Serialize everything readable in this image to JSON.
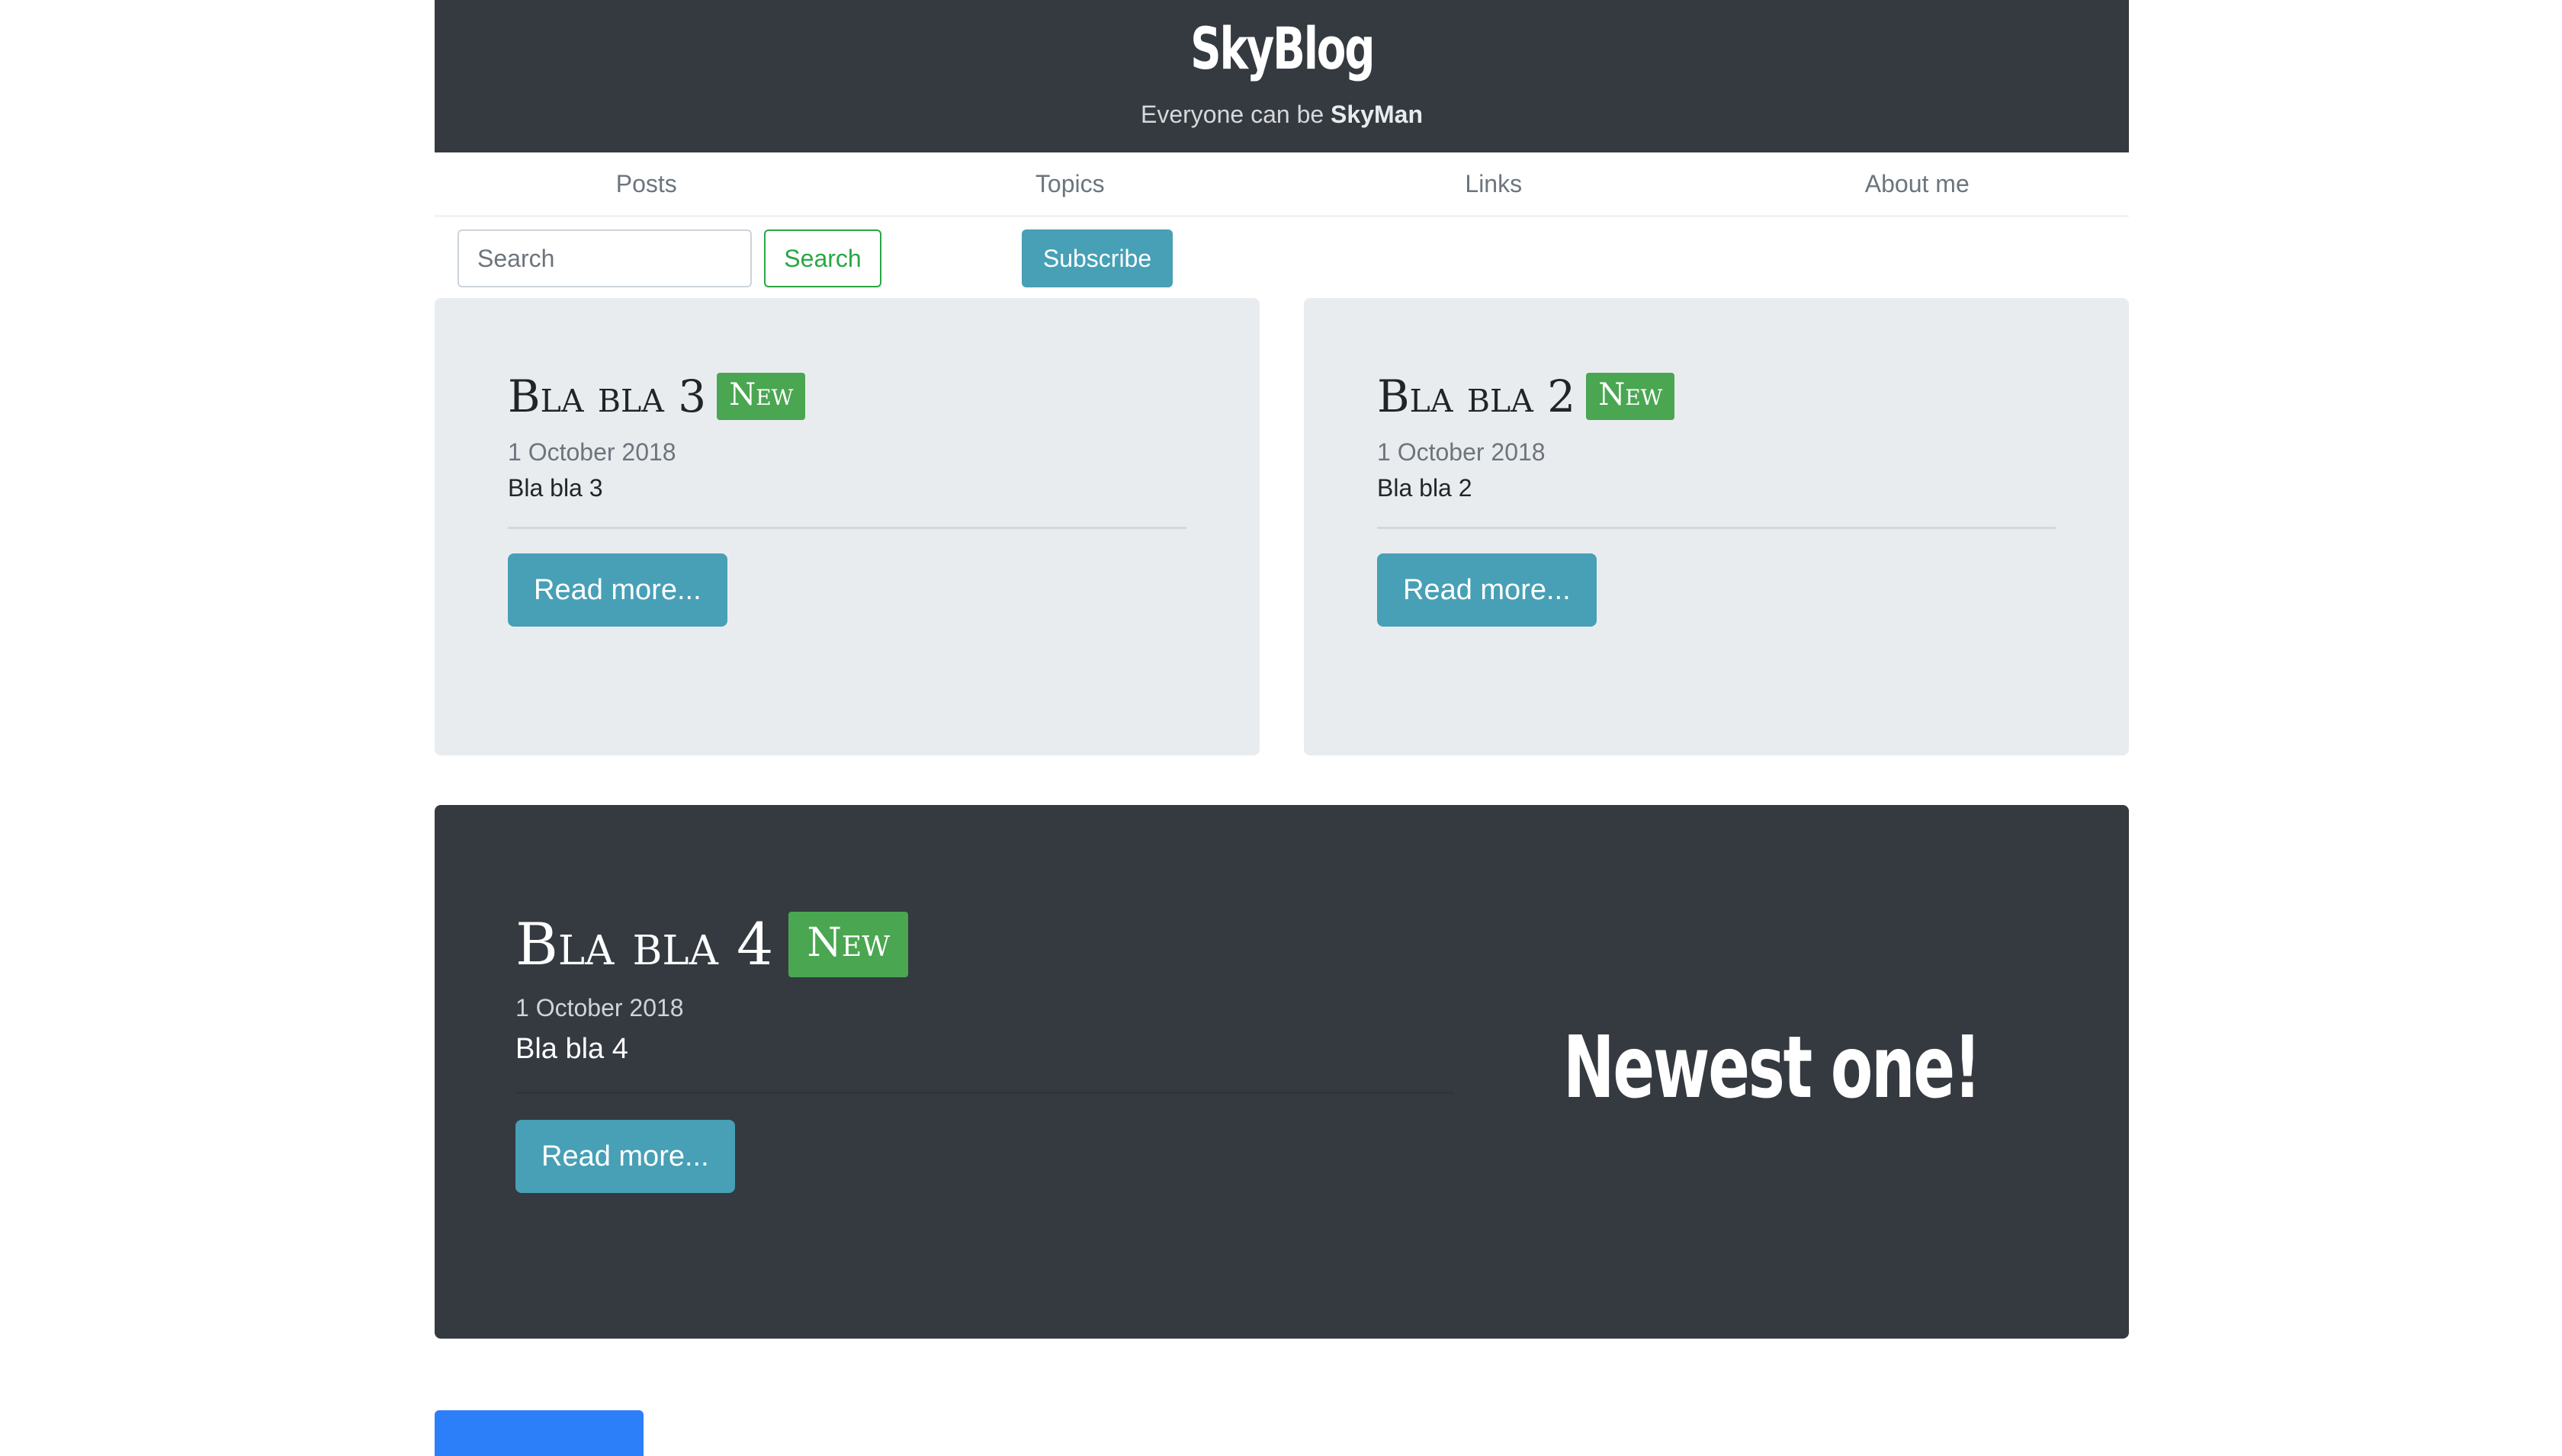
{
  "header": {
    "brand": "SkyBlog",
    "tagline_prefix": "Everyone can be",
    "tagline_name": "SkyMan"
  },
  "nav": {
    "items": [
      "Posts",
      "Topics",
      "Links",
      "About me"
    ]
  },
  "toolbar": {
    "search_placeholder": "Search",
    "search_button": "Search",
    "subscribe_button": "Subscribe"
  },
  "posts": [
    {
      "title": "Bla bla 3",
      "badge": "New",
      "date": "1 October 2018",
      "excerpt": "Bla bla 3",
      "read_more": "Read more..."
    },
    {
      "title": "Bla bla 2",
      "badge": "New",
      "date": "1 October 2018",
      "excerpt": "Bla bla 2",
      "read_more": "Read more..."
    }
  ],
  "featured": {
    "title": "Bla bla 4",
    "badge": "New",
    "date": "1 October 2018",
    "excerpt": "Bla bla 4",
    "read_more": "Read more...",
    "headline": "Newest one!"
  },
  "colors": {
    "dark": "#343a40",
    "accent": "#47a0b6",
    "badge": "#4aa651",
    "success": "#28a745",
    "primary": "#2d7ff9"
  }
}
